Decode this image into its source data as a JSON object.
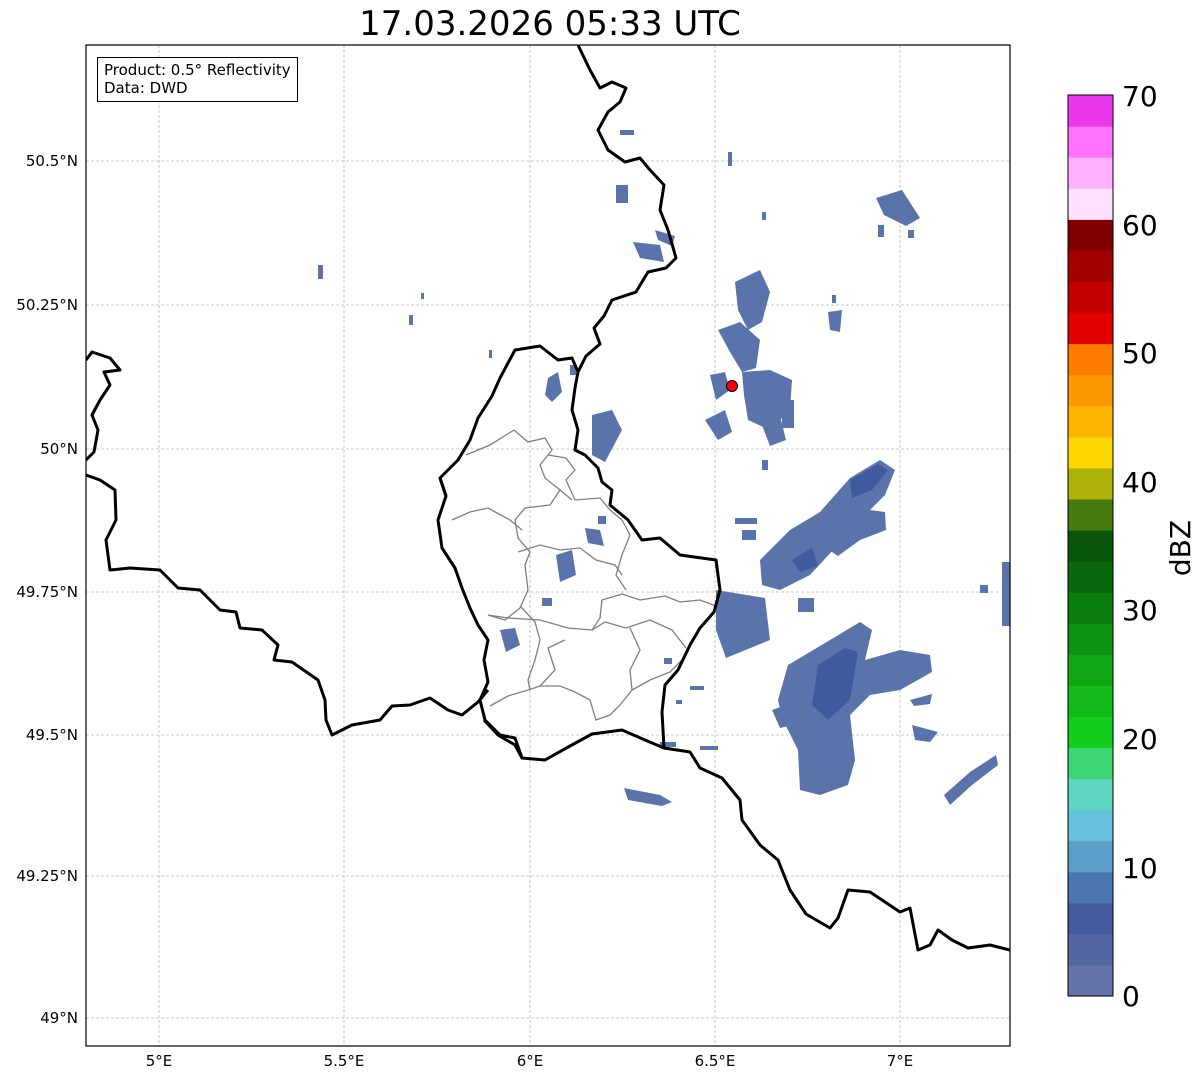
{
  "title": "17.03.2026 05:33 UTC",
  "info_box": {
    "product": "Product: 0.5° Reflectivity",
    "data": "Data: DWD"
  },
  "lat_ticks": [
    "50.5°N",
    "50.25°N",
    "50°N",
    "49.75°N",
    "49.5°N",
    "49.25°N",
    "49°N"
  ],
  "lon_ticks": [
    "5°E",
    "5.5°E",
    "6°E",
    "6.5°E",
    "7°E"
  ],
  "colorbar": {
    "label": "dBZ",
    "ticks": [
      "0",
      "10",
      "20",
      "30",
      "40",
      "50",
      "60",
      "70"
    ],
    "colors": [
      "#6474a8",
      "#52669f",
      "#44599f",
      "#4a77b0",
      "#5b9ec8",
      "#66c2dc",
      "#5fd6c2",
      "#3ed573",
      "#14cc1c",
      "#13ba18",
      "#10a614",
      "#0e9211",
      "#0b7d0e",
      "#0a6810",
      "#085408",
      "#477a0c",
      "#adb20a",
      "#fed800",
      "#fdb600",
      "#fd9900",
      "#fd7c00",
      "#e30000",
      "#c20000",
      "#a30000",
      "#800000",
      "#ffe1ff",
      "#ffb0ff",
      "#ff73ff",
      "#ec36ec"
    ]
  },
  "map": {
    "lon_range": [
      4.8,
      7.3
    ],
    "lat_range": [
      48.95,
      50.7
    ],
    "radar_site": {
      "lon": 6.548,
      "lat": 50.11,
      "color": "#ff0000"
    },
    "echo_color": "#5a74ab",
    "echo_color_strong": "#3f5a9e"
  }
}
